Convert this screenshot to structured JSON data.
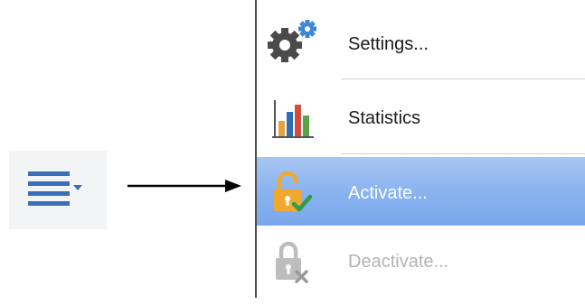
{
  "menu_button": {
    "icon": "hamburger-dropdown-icon",
    "color": "#3b6fb8"
  },
  "arrow": {
    "icon": "right-arrow",
    "color": "#000000"
  },
  "menu": {
    "items": [
      {
        "label": "Settings...",
        "icon": "gear-icon",
        "state": "enabled"
      },
      {
        "label": "Statistics",
        "icon": "bar-chart-icon",
        "state": "enabled"
      },
      {
        "label": "Activate...",
        "icon": "unlock-check-icon",
        "state": "highlighted"
      },
      {
        "label": "Deactivate...",
        "icon": "lock-x-icon",
        "state": "disabled"
      }
    ],
    "highlight_color": "#8ab3ef",
    "disabled_text_color": "#b3b3b3"
  }
}
